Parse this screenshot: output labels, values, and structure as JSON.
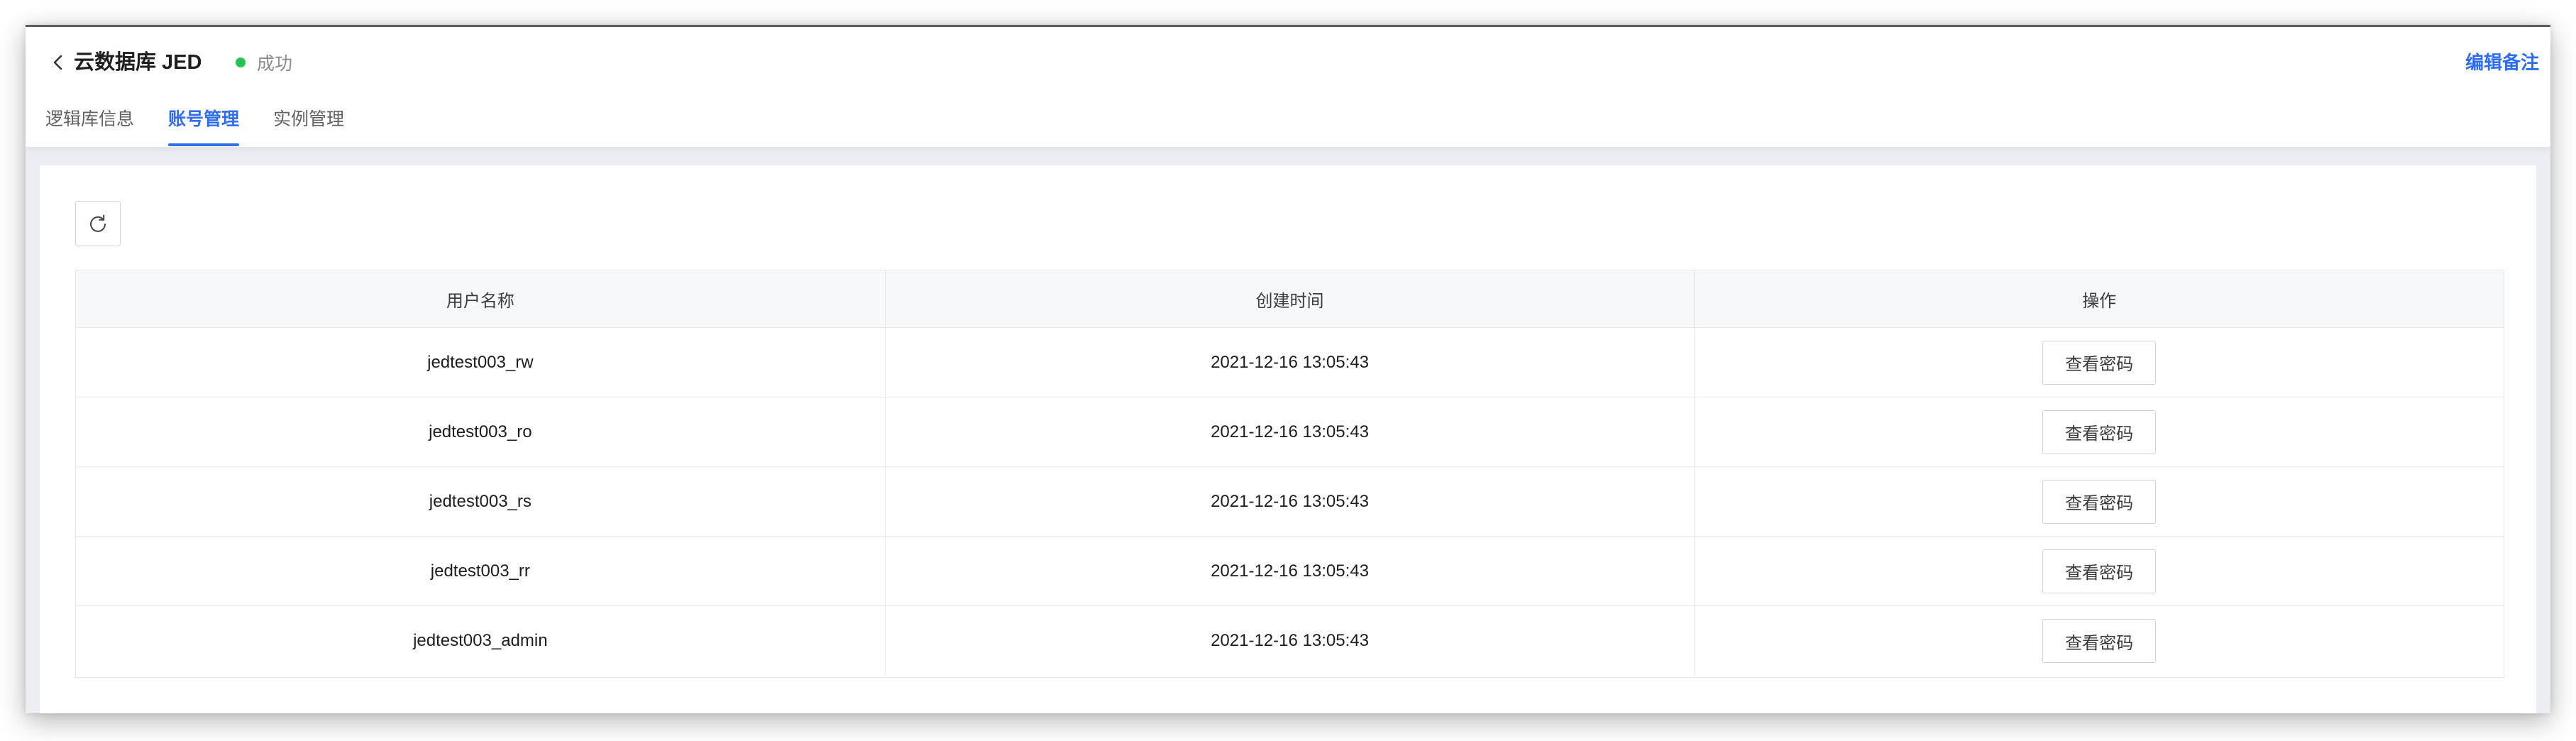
{
  "header": {
    "title": "云数据库 JED",
    "status": {
      "text": "成功",
      "color": "#25c451"
    },
    "edit_note_label": "编辑备注",
    "accent_color": "#2f6df0"
  },
  "tabs": [
    {
      "label": "逻辑库信息",
      "active": false
    },
    {
      "label": "账号管理",
      "active": true
    },
    {
      "label": "实例管理",
      "active": false
    }
  ],
  "toolbar": {
    "refresh_icon": "refresh-icon"
  },
  "table": {
    "columns": [
      "用户名称",
      "创建时间",
      "操作"
    ],
    "rows": [
      {
        "username": "jedtest003_rw",
        "created": "2021-12-16 13:05:43",
        "action": "查看密码"
      },
      {
        "username": "jedtest003_ro",
        "created": "2021-12-16 13:05:43",
        "action": "查看密码"
      },
      {
        "username": "jedtest003_rs",
        "created": "2021-12-16 13:05:43",
        "action": "查看密码"
      },
      {
        "username": "jedtest003_rr",
        "created": "2021-12-16 13:05:43",
        "action": "查看密码"
      },
      {
        "username": "jedtest003_admin",
        "created": "2021-12-16 13:05:43",
        "action": "查看密码"
      }
    ]
  }
}
